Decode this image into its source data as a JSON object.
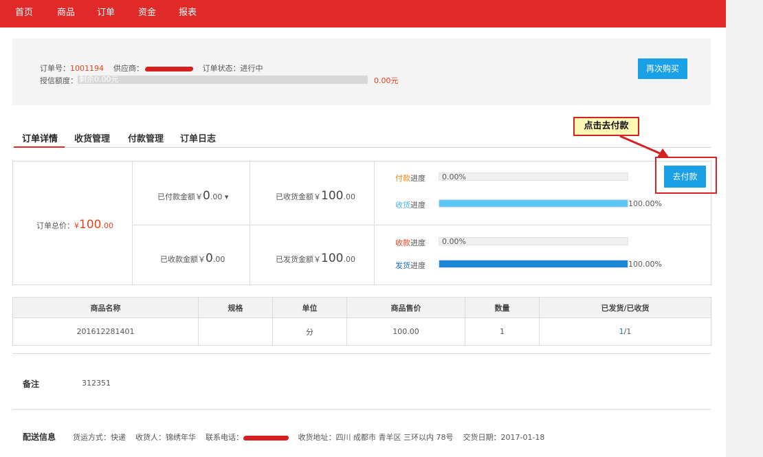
{
  "nav": {
    "items": [
      "首页",
      "商品",
      "订单",
      "资金",
      "报表"
    ]
  },
  "summary": {
    "order_no_label": "订单号：",
    "order_no": "1001194",
    "supplier_label": "供应商：",
    "status_label": "订单状态：",
    "status": "进行中",
    "credit_label": "授信额度：",
    "credit_bar_text": "剩余0.00元",
    "credit_value": "0.00元",
    "rebuy_label": "再次购买"
  },
  "tabs": [
    "订单详情",
    "收货管理",
    "付款管理",
    "订单日志"
  ],
  "callout": {
    "text": "点击去付款",
    "border_color": "#d52121",
    "bg_color": "#fff8b4"
  },
  "info": {
    "total_label": "订单总价：",
    "total_currency": "¥",
    "total_int": "100",
    "total_dec": ".00",
    "paid_label": "已付款金额￥",
    "paid_int": "0",
    "paid_dec": ".00",
    "paid_caret": "▾",
    "received_goods_label": "已收货金额￥",
    "received_goods_int": "100",
    "received_goods_dec": ".00",
    "collected_label": "已收款金额￥",
    "collected_int": "0",
    "collected_dec": ".00",
    "shipped_label": "已发货金额￥",
    "shipped_int": "100",
    "shipped_dec": ".00",
    "progress": [
      {
        "label_a": "付款",
        "label_b": "进度",
        "value": "0.00%",
        "fraction": 0.0,
        "label_a_color": "#e8891e",
        "fill_color": "#6ecff6"
      },
      {
        "label_a": "收货",
        "label_b": "进度",
        "value": "100.00%",
        "fraction": 1.0,
        "label_a_color": "#4ab3e8",
        "fill_color": "#5dc8f5"
      },
      {
        "label_a": "收款",
        "label_b": "进度",
        "value": "0.00%",
        "fraction": 0.0,
        "label_a_color": "#e8421e",
        "fill_color": "#1a87d8"
      },
      {
        "label_a": "发货",
        "label_b": "进度",
        "value": "100.00%",
        "fraction": 1.0,
        "label_a_color": "#1a6fc2",
        "fill_color": "#1a87d8"
      }
    ],
    "pay_button": "去付款"
  },
  "goods_table": {
    "headers": [
      "商品名称",
      "规格",
      "单位",
      "商品售价",
      "数量",
      "已发货/已收货"
    ],
    "rows": [
      {
        "name": "201612281401",
        "spec": "",
        "unit": "分",
        "price": "100.00",
        "qty": "1",
        "shipped": "1",
        "received": "/1"
      }
    ]
  },
  "remark": {
    "title": "备注",
    "text": "312351"
  },
  "delivery": {
    "title": "配送信息",
    "method": "货运方式：快递",
    "receiver": "收货人：锦绣年华",
    "phone_label": "联系电话：",
    "address": "收货地址：四川 成都市 青羊区 三环以内 78号",
    "date": "交货日期：2017-01-18"
  },
  "colors": {
    "brand_red": "#e02a2a",
    "accent_blue": "#1aa0e6"
  }
}
